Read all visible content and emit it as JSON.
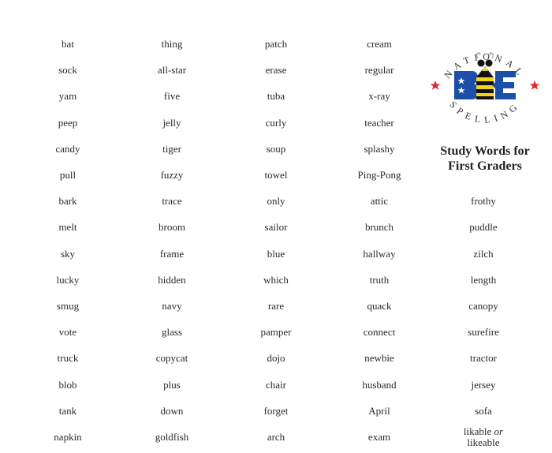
{
  "logo": {
    "arc_text": "NATIONAL SPELLING",
    "arc_top": "NATIONAL",
    "arc_bottom": "SPELLING",
    "center_text": "BEE",
    "colors": {
      "blue": "#1b4fa8",
      "yellow": "#f2d21b",
      "black": "#111111",
      "star_red": "#e0262b"
    },
    "name": "National Spelling Bee logo"
  },
  "title": {
    "line1": "Study Words for",
    "line2": "First Graders"
  },
  "columns": [
    [
      "bat",
      "sock",
      "yam",
      "peep",
      "candy",
      "pull",
      "bark",
      "melt",
      "sky",
      "lucky",
      "smug",
      "vote",
      "truck",
      "blob",
      "tank",
      "napkin"
    ],
    [
      "thing",
      "all-star",
      "five",
      "jelly",
      "tiger",
      "fuzzy",
      "trace",
      "broom",
      "frame",
      "hidden",
      "navy",
      "glass",
      "copycat",
      "plus",
      "down",
      "goldfish"
    ],
    [
      "patch",
      "erase",
      "tuba",
      "curly",
      "soup",
      "towel",
      "only",
      "sailor",
      "blue",
      "which",
      "rare",
      "pamper",
      "dojo",
      "chair",
      "forget",
      "arch"
    ],
    [
      "cream",
      "regular",
      "x-ray",
      "teacher",
      "splashy",
      "Ping-Pong",
      "attic",
      "brunch",
      "hallway",
      "truth",
      "quack",
      "connect",
      "newbie",
      "husband",
      "April",
      "exam"
    ],
    [
      "frothy",
      "puddle",
      "zilch",
      "length",
      "canopy",
      "surefire",
      "tractor",
      "jersey",
      "sofa"
    ]
  ],
  "last_entry": {
    "word1": "likable",
    "connector": "or",
    "word2": "likeable"
  }
}
